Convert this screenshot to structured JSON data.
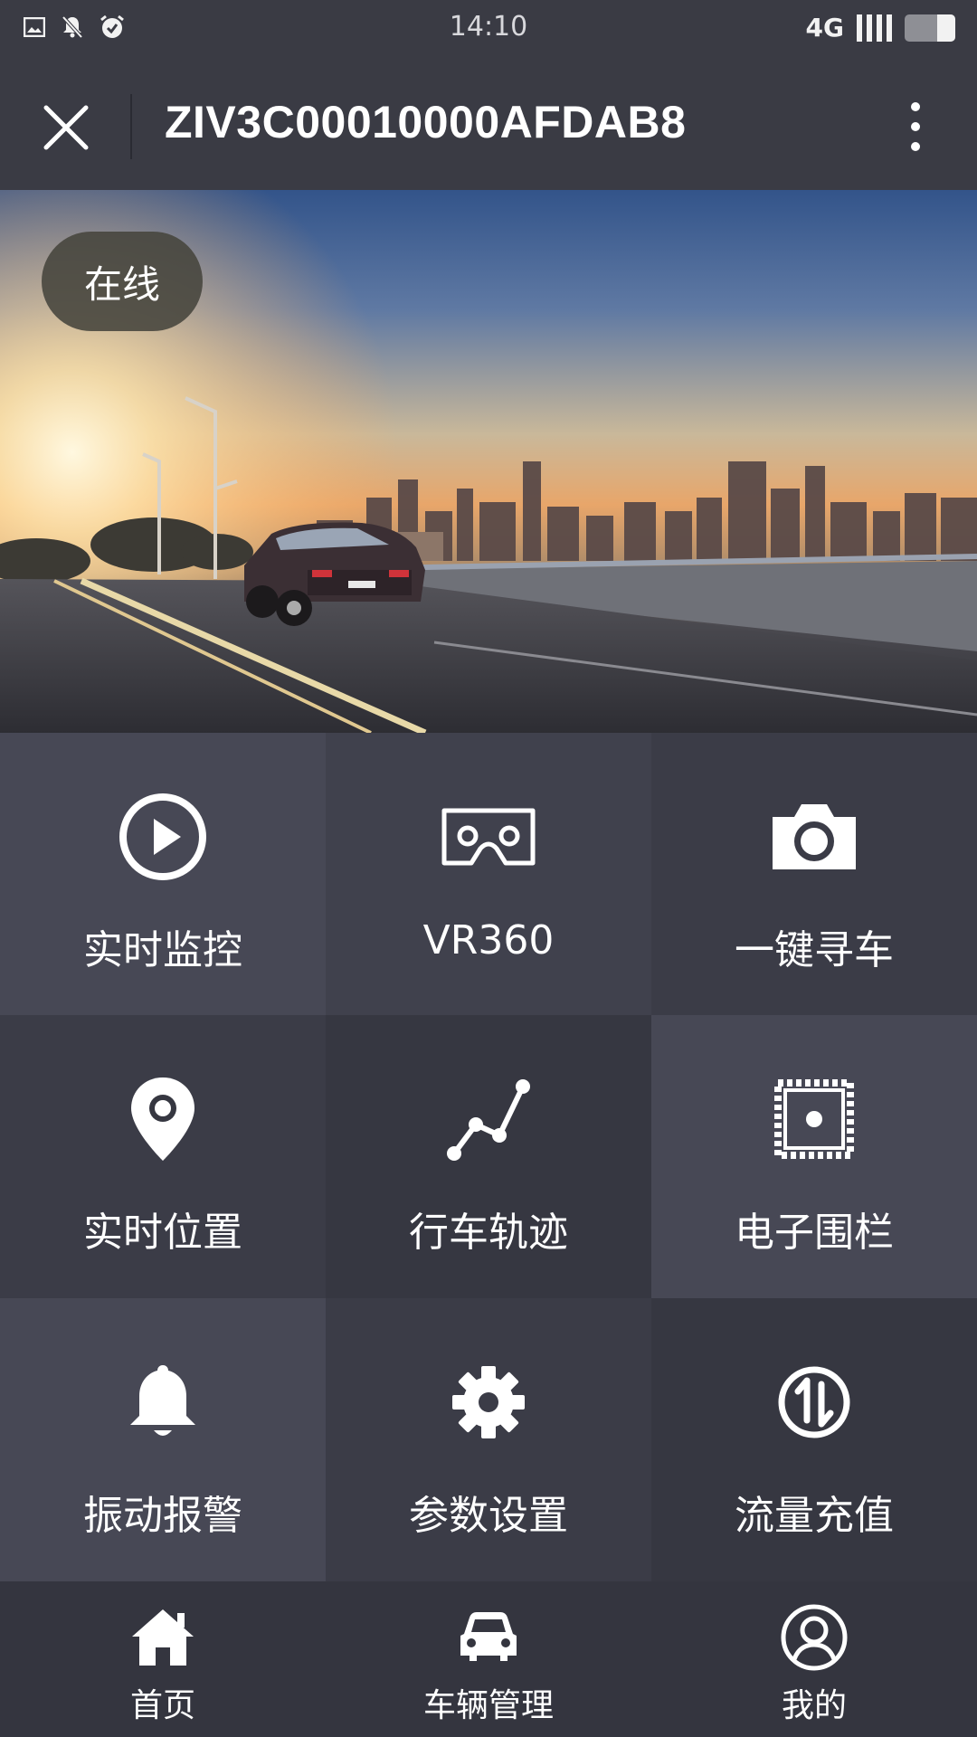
{
  "status_bar": {
    "time": "14:10",
    "network": "4G",
    "left_icons": [
      "image-icon",
      "bell-off-icon",
      "alarm-icon"
    ]
  },
  "header": {
    "title": "ZIV3C00010000AFDAB8",
    "close_icon": "close-icon",
    "more_icon": "more-vertical-icon"
  },
  "banner": {
    "status": "在线"
  },
  "features": [
    {
      "label": "实时监控",
      "icon": "play-circle-icon"
    },
    {
      "label": "VR360",
      "icon": "vr-headset-icon"
    },
    {
      "label": "一键寻车",
      "icon": "camera-icon"
    },
    {
      "label": "实时位置",
      "icon": "location-pin-icon"
    },
    {
      "label": "行车轨迹",
      "icon": "track-line-icon"
    },
    {
      "label": "电子围栏",
      "icon": "geofence-icon"
    },
    {
      "label": "振动报警",
      "icon": "bell-icon"
    },
    {
      "label": "参数设置",
      "icon": "gear-icon"
    },
    {
      "label": "流量充值",
      "icon": "data-transfer-icon"
    }
  ],
  "bottom_nav": [
    {
      "label": "首页",
      "icon": "home-icon"
    },
    {
      "label": "车辆管理",
      "icon": "car-icon"
    },
    {
      "label": "我的",
      "icon": "user-icon"
    }
  ]
}
